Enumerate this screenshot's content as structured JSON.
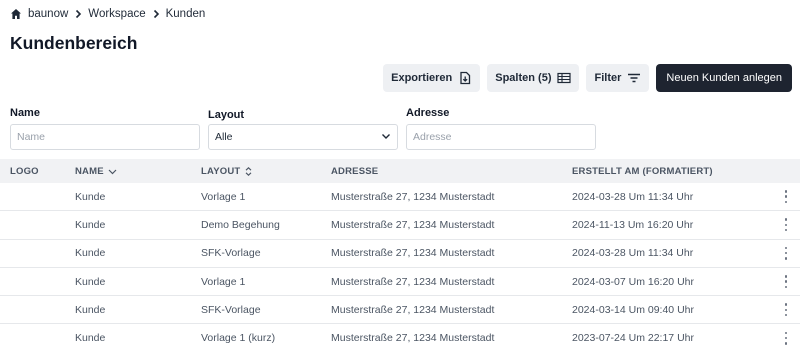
{
  "breadcrumb": {
    "items": [
      "baunow",
      "Workspace",
      "Kunden"
    ]
  },
  "page": {
    "title": "Kundenbereich"
  },
  "toolbar": {
    "export_label": "Exportieren",
    "columns_label": "Spalten (5)",
    "filter_label": "Filter",
    "new_customer_label": "Neuen Kunden anlegen"
  },
  "filters": {
    "name": {
      "label": "Name",
      "placeholder": "Name"
    },
    "layout": {
      "label": "Layout",
      "value": "Alle"
    },
    "adresse": {
      "label": "Adresse",
      "placeholder": "Adresse"
    }
  },
  "table": {
    "columns": [
      "LOGO",
      "NAME",
      "LAYOUT",
      "ADRESSE",
      "ERSTELLT AM (FORMATIERT)"
    ],
    "rows": [
      {
        "logo": "",
        "name": "Kunde",
        "layout": "Vorlage 1",
        "adresse": "Musterstraße 27, 1234 Musterstadt",
        "erstellt": "2024-03-28 Um 11:34 Uhr"
      },
      {
        "logo": "",
        "name": "Kunde",
        "layout": "Demo Begehung",
        "adresse": "Musterstraße 27, 1234 Musterstadt",
        "erstellt": "2024-11-13 Um 16:20 Uhr"
      },
      {
        "logo": "",
        "name": "Kunde",
        "layout": "SFK-Vorlage",
        "adresse": "Musterstraße 27, 1234 Musterstadt",
        "erstellt": "2024-03-28 Um 11:34 Uhr"
      },
      {
        "logo": "",
        "name": "Kunde",
        "layout": "Vorlage 1",
        "adresse": "Musterstraße 27, 1234 Musterstadt",
        "erstellt": "2024-03-07 Um 16:20 Uhr"
      },
      {
        "logo": "",
        "name": "Kunde",
        "layout": "SFK-Vorlage",
        "adresse": "Musterstraße 27, 1234 Musterstadt",
        "erstellt": "2024-03-14 Um 09:40 Uhr"
      },
      {
        "logo": "",
        "name": "Kunde",
        "layout": "Vorlage 1 (kurz)",
        "adresse": "Musterstraße 27, 1234 Musterstadt",
        "erstellt": "2023-07-24 Um 22:17 Uhr"
      }
    ]
  },
  "icons": {
    "home": "home-icon",
    "chevron": "chevron-right-icon",
    "export": "file-export-icon",
    "columns": "table-columns-icon",
    "filter": "filter-lines-icon",
    "sort_desc": "chevron-down-icon",
    "sort_both": "sort-updown-icon",
    "select": "chevron-down-icon",
    "row_menu": "kebab-menu-icon"
  },
  "colors": {
    "primary_button": "#1e2430",
    "secondary_button": "#eef0f3",
    "header_bg": "#f1f2f4"
  }
}
